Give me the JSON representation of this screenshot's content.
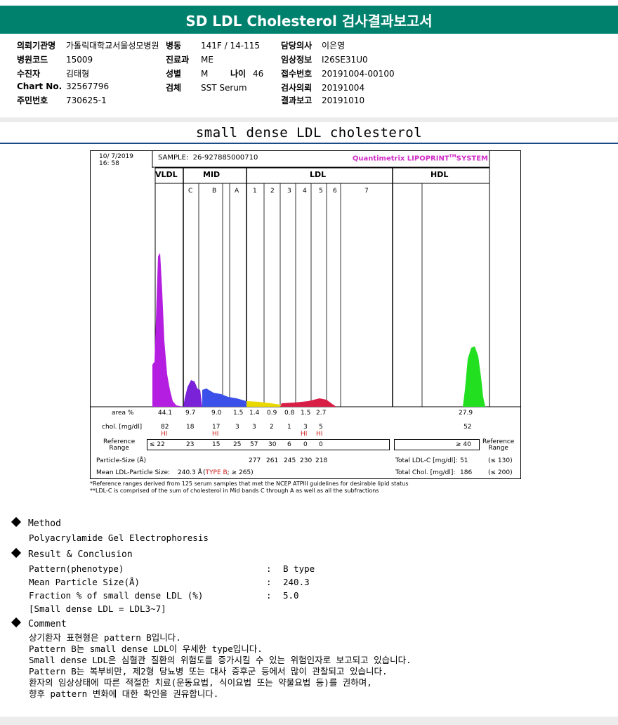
{
  "header": {
    "title": "SD LDL Cholesterol 검사결과보고서"
  },
  "patient_info": {
    "institution_label": "의뢰기관명",
    "institution": "가톨릭대학교서울성모병원",
    "ward_label": "병동",
    "ward": "141F / 14-115",
    "doctor_label": "담당의사",
    "doctor": "이은영",
    "hospital_code_label": "병원코드",
    "hospital_code": "15009",
    "department_label": "진료과",
    "department": "ME",
    "clinical_info_label": "임상정보",
    "clinical_info": "I26SE31U0",
    "patient_label": "수진자",
    "patient": "김태형",
    "sex_label": "성별",
    "sex": "M",
    "age_label": "나이",
    "age": "46",
    "receipt_label": "접수번호",
    "receipt": "20191004-00100",
    "chart_label": "Chart No.",
    "chart": "32567796",
    "specimen_label": "검체",
    "specimen": "SST Serum",
    "request_label": "검사의뢰",
    "request": "20191004",
    "id_label": "주민번호",
    "id": "730625-1",
    "report_label": "결과보고",
    "report": "20191010"
  },
  "section_title": "small dense LDL cholesterol",
  "report": {
    "date": "10/ 7/2019",
    "time": "16: 58",
    "sample_label": "SAMPLE:",
    "sample": "26-927885000710",
    "logo_main": "Quantimetrix LIPOPRINT",
    "logo_tm": "TM",
    "logo_end": "SYSTEM",
    "groups": [
      "VLDL",
      "MID",
      "LDL",
      "HDL"
    ],
    "mid_bands": [
      "C",
      "B",
      "A"
    ],
    "ldl_bands": [
      "1",
      "2",
      "3",
      "4",
      "5",
      "6",
      "7"
    ],
    "area_label": "area %",
    "area_values": [
      "44.1",
      "9.7",
      "9.0",
      "1.5",
      "1.4",
      "0.9",
      "0.8",
      "1.5",
      "2.7"
    ],
    "area_hdl": "27.9",
    "chol_label": "chol. [mg/dl]",
    "chol_values": [
      "82",
      "18",
      "17",
      "3",
      "3",
      "2",
      "1",
      "3",
      "5"
    ],
    "chol_hdl": "52",
    "hi_flag": "HI",
    "ref_label_1": "Reference",
    "ref_label_2": "Range",
    "ref_values": [
      "≤ 22",
      "23",
      "15",
      "25",
      "57",
      "30",
      "6",
      "0",
      "0"
    ],
    "ref_hdl": "≥ 40",
    "ref_right_1": "Reference",
    "ref_right_2": "Range",
    "particle_label": "Particle-Size (Å)",
    "particle_values": [
      "277",
      "261",
      "245",
      "230",
      "218"
    ],
    "total_ldl_label": "Total LDL-C [mg/dl]:",
    "total_ldl": "51",
    "total_ldl_ref": "(≤ 130)",
    "mean_label": "Mean LDL-Particle Size:",
    "mean_value": "240.3 Å",
    "mean_type": "TYPE B",
    "mean_ref": "; ≥ 265)",
    "total_chol_label": "Total Chol. [mg/dl]:",
    "total_chol": "186",
    "total_chol_ref": "(≤ 200)",
    "footnote_1": "*Reference ranges derived from 125 serum samples that met the NCEP ATPIII guidelines for desirable lipid status",
    "footnote_2": "**LDL-C is comprised of the sum of cholesterol in Mid bands C through A as well as all the subfractions"
  },
  "method": {
    "title": "Method",
    "text": "Polyacrylamide Gel Electrophoresis"
  },
  "result": {
    "title": "Result & Conclusion",
    "rows": [
      {
        "label": "Pattern(phenotype)",
        "value": "B type"
      },
      {
        "label": "Mean Particle Size(Å)",
        "value": "240.3"
      },
      {
        "label": "Fraction % of small dense LDL (%)",
        "value": "5.0"
      }
    ],
    "colon": ":",
    "note": "[Small dense LDL = LDL3~7]"
  },
  "comment": {
    "title": "Comment",
    "lines": [
      "상기환자 표현형은 pattern B입니다.",
      "Pattern B는 small dense LDL이 우세한 type입니다.",
      "Small dense LDL은 심혈관 질환의 위험도를 증가시킬 수 있는 위험인자로 보고되고 있습니다.",
      "Pattern B는 복부비만, 제2형 당뇨병 또는 대사 증후군 등에서 많이 관찰되고 있습니다.",
      "환자의 임상상태에 따른 적절한 치료(운동요법, 식이요법 또는 약물요법 등)를 권하며,",
      "향후 pattern 변화에 대한 확인을 권유합니다."
    ]
  },
  "colors": {
    "header_bg": "#00816e",
    "vldl": "#b41ee0",
    "mid_c": "#7a22d8",
    "mid_b": "#3a50e8",
    "ldl_low": "#e8d800",
    "ldl_high": "#d81e46",
    "hdl": "#22e020"
  }
}
